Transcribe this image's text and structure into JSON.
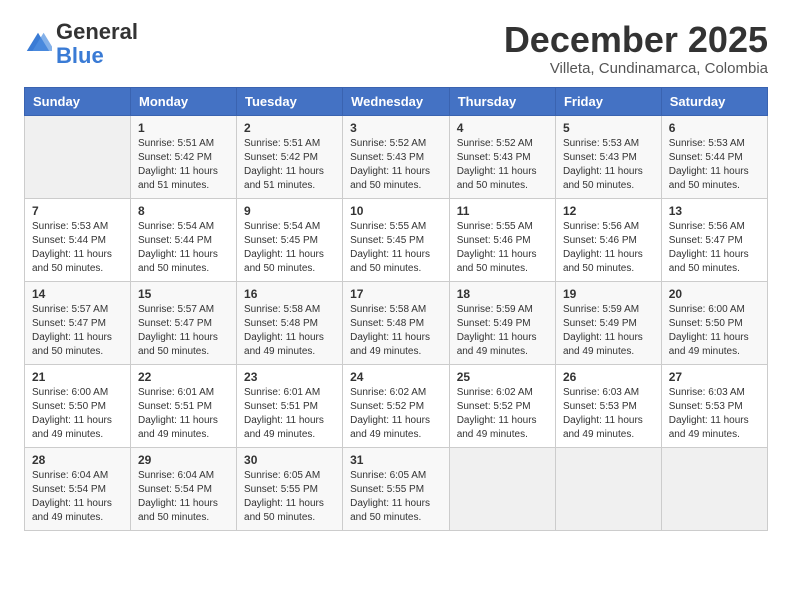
{
  "logo": {
    "general": "General",
    "blue": "Blue"
  },
  "title": "December 2025",
  "location": "Villeta, Cundinamarca, Colombia",
  "days_of_week": [
    "Sunday",
    "Monday",
    "Tuesday",
    "Wednesday",
    "Thursday",
    "Friday",
    "Saturday"
  ],
  "weeks": [
    [
      {
        "day": "",
        "info": ""
      },
      {
        "day": "1",
        "info": "Sunrise: 5:51 AM\nSunset: 5:42 PM\nDaylight: 11 hours\nand 51 minutes."
      },
      {
        "day": "2",
        "info": "Sunrise: 5:51 AM\nSunset: 5:42 PM\nDaylight: 11 hours\nand 51 minutes."
      },
      {
        "day": "3",
        "info": "Sunrise: 5:52 AM\nSunset: 5:43 PM\nDaylight: 11 hours\nand 50 minutes."
      },
      {
        "day": "4",
        "info": "Sunrise: 5:52 AM\nSunset: 5:43 PM\nDaylight: 11 hours\nand 50 minutes."
      },
      {
        "day": "5",
        "info": "Sunrise: 5:53 AM\nSunset: 5:43 PM\nDaylight: 11 hours\nand 50 minutes."
      },
      {
        "day": "6",
        "info": "Sunrise: 5:53 AM\nSunset: 5:44 PM\nDaylight: 11 hours\nand 50 minutes."
      }
    ],
    [
      {
        "day": "7",
        "info": ""
      },
      {
        "day": "8",
        "info": "Sunrise: 5:54 AM\nSunset: 5:44 PM\nDaylight: 11 hours\nand 50 minutes."
      },
      {
        "day": "9",
        "info": "Sunrise: 5:54 AM\nSunset: 5:45 PM\nDaylight: 11 hours\nand 50 minutes."
      },
      {
        "day": "10",
        "info": "Sunrise: 5:55 AM\nSunset: 5:45 PM\nDaylight: 11 hours\nand 50 minutes."
      },
      {
        "day": "11",
        "info": "Sunrise: 5:55 AM\nSunset: 5:46 PM\nDaylight: 11 hours\nand 50 minutes."
      },
      {
        "day": "12",
        "info": "Sunrise: 5:56 AM\nSunset: 5:46 PM\nDaylight: 11 hours\nand 50 minutes."
      },
      {
        "day": "13",
        "info": "Sunrise: 5:56 AM\nSunset: 5:47 PM\nDaylight: 11 hours\nand 50 minutes."
      }
    ],
    [
      {
        "day": "14",
        "info": ""
      },
      {
        "day": "15",
        "info": "Sunrise: 5:57 AM\nSunset: 5:47 PM\nDaylight: 11 hours\nand 50 minutes."
      },
      {
        "day": "16",
        "info": "Sunrise: 5:58 AM\nSunset: 5:48 PM\nDaylight: 11 hours\nand 49 minutes."
      },
      {
        "day": "17",
        "info": "Sunrise: 5:58 AM\nSunset: 5:48 PM\nDaylight: 11 hours\nand 49 minutes."
      },
      {
        "day": "18",
        "info": "Sunrise: 5:59 AM\nSunset: 5:49 PM\nDaylight: 11 hours\nand 49 minutes."
      },
      {
        "day": "19",
        "info": "Sunrise: 5:59 AM\nSunset: 5:49 PM\nDaylight: 11 hours\nand 49 minutes."
      },
      {
        "day": "20",
        "info": "Sunrise: 6:00 AM\nSunset: 5:50 PM\nDaylight: 11 hours\nand 49 minutes."
      }
    ],
    [
      {
        "day": "21",
        "info": ""
      },
      {
        "day": "22",
        "info": "Sunrise: 6:01 AM\nSunset: 5:51 PM\nDaylight: 11 hours\nand 49 minutes."
      },
      {
        "day": "23",
        "info": "Sunrise: 6:01 AM\nSunset: 5:51 PM\nDaylight: 11 hours\nand 49 minutes."
      },
      {
        "day": "24",
        "info": "Sunrise: 6:02 AM\nSunset: 5:52 PM\nDaylight: 11 hours\nand 49 minutes."
      },
      {
        "day": "25",
        "info": "Sunrise: 6:02 AM\nSunset: 5:52 PM\nDaylight: 11 hours\nand 49 minutes."
      },
      {
        "day": "26",
        "info": "Sunrise: 6:03 AM\nSunset: 5:53 PM\nDaylight: 11 hours\nand 49 minutes."
      },
      {
        "day": "27",
        "info": "Sunrise: 6:03 AM\nSunset: 5:53 PM\nDaylight: 11 hours\nand 49 minutes."
      }
    ],
    [
      {
        "day": "28",
        "info": "Sunrise: 6:04 AM\nSunset: 5:54 PM\nDaylight: 11 hours\nand 49 minutes."
      },
      {
        "day": "29",
        "info": "Sunrise: 6:04 AM\nSunset: 5:54 PM\nDaylight: 11 hours\nand 50 minutes."
      },
      {
        "day": "30",
        "info": "Sunrise: 6:05 AM\nSunset: 5:55 PM\nDaylight: 11 hours\nand 50 minutes."
      },
      {
        "day": "31",
        "info": "Sunrise: 6:05 AM\nSunset: 5:55 PM\nDaylight: 11 hours\nand 50 minutes."
      },
      {
        "day": "",
        "info": ""
      },
      {
        "day": "",
        "info": ""
      },
      {
        "day": "",
        "info": ""
      }
    ]
  ],
  "week1_sun_info": "Sunrise: 5:53 AM\nSunset: 5:44 PM\nDaylight: 11 hours\nand 50 minutes.",
  "week2_sun_info": "Sunrise: 5:53 AM\nSunset: 5:44 PM\nDaylight: 11 hours\nand 50 minutes.",
  "week3_sun_info": "Sunrise: 5:57 AM\nSunset: 5:47 PM\nDaylight: 11 hours\nand 50 minutes.",
  "week4_sun_info": "Sunrise: 6:00 AM\nSunset: 5:50 PM\nDaylight: 11 hours\nand 49 minutes."
}
